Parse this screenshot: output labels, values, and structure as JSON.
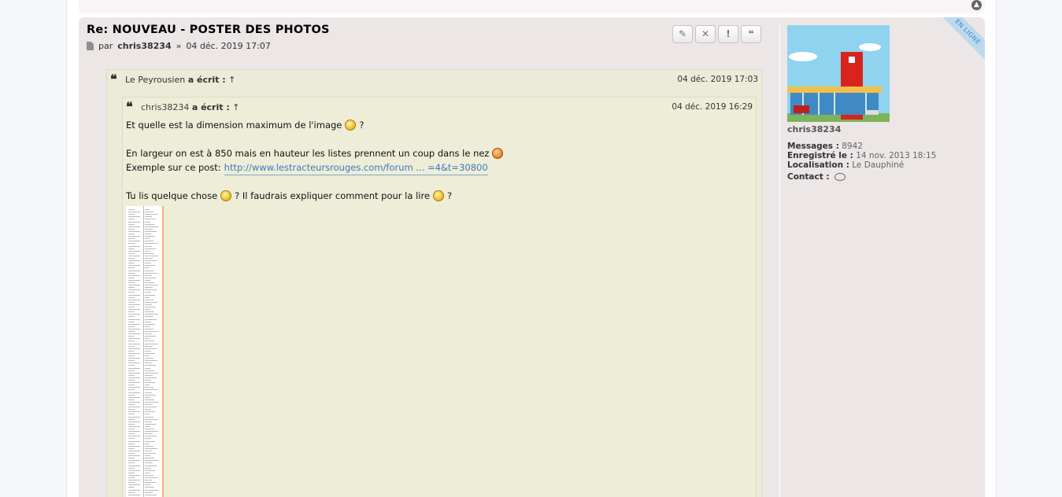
{
  "post": {
    "title": "Re: NOUVEAU - POSTER DES PHOTOS",
    "meta_prefix": "par",
    "author": "chris38234",
    "meta_sep": "»",
    "date": "04 déc. 2019 17:07",
    "buttons": {
      "edit": "✎",
      "delete": "✕",
      "report": "!",
      "quote": "❝"
    }
  },
  "profile": {
    "ribbon": "EN LIGNE",
    "name": "chris38234",
    "messages_label": "Messages :",
    "messages": "8942",
    "registered_label": "Enregistré le :",
    "registered": "14 nov. 2013 18:15",
    "location_label": "Localisation :",
    "location": "Le Dauphiné",
    "contact_label": "Contact :"
  },
  "quote_outer": {
    "icon": "❝",
    "name": "Le Peyrousien",
    "wrote": "a écrit :",
    "arrow": "↑",
    "date": "04 déc. 2019 17:03"
  },
  "quote_inner": {
    "icon": "❝",
    "name": "chris38234",
    "wrote": "a écrit :",
    "arrow": "↑",
    "date": "04 déc. 2019 16:29",
    "line1_a": "Et quelle est la dimension maximum de l'image",
    "line1_b": "?",
    "line2_a": "En largeur on est à 850 mais en hauteur les listes prennent un coup dans le nez",
    "line3_a": "Exemple sur ce post:",
    "line3_link": "http://www.lestracteursrouges.com/forum ... =4&t=30800",
    "line4_a": "Tu lis quelque chose",
    "line4_b": "? Il faudrais expliquer comment pour la lire",
    "line4_c": "?"
  },
  "icons": {
    "top": "back-to-top-icon",
    "file": "file-icon",
    "contact": "speech-bubble-icon"
  }
}
